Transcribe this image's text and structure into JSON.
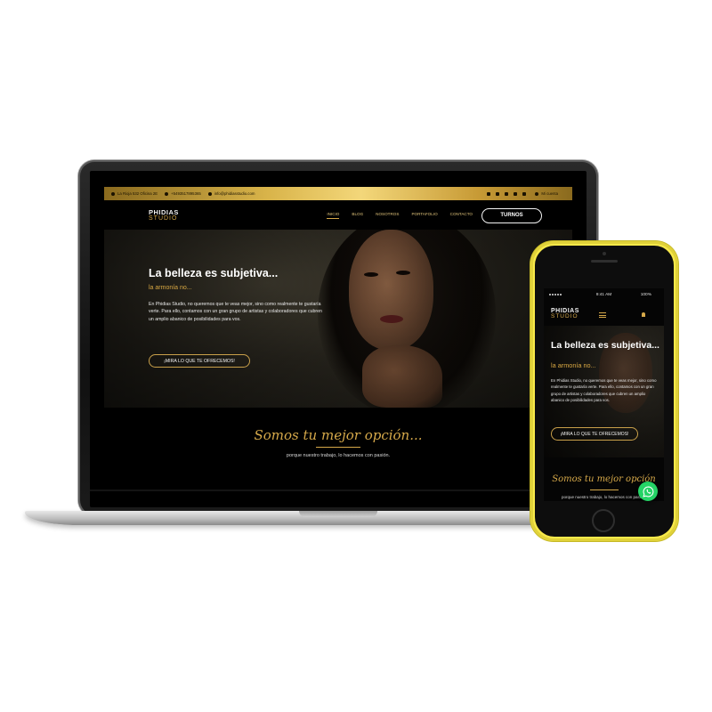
{
  "desktop": {
    "topbar": {
      "address": "La Rioja 532 Oficina 2E",
      "phone": "+5493517895365",
      "email": "info@phidiasstudio.com",
      "account_label": "Mi cuenta",
      "socials": [
        "facebook-icon",
        "twitter-icon",
        "youtube-icon",
        "tiktok-icon",
        "instagram-icon"
      ]
    },
    "logo": {
      "top": "PHIDIAS",
      "bottom": "STUDIO"
    },
    "nav": [
      "INICIO",
      "BLOG",
      "NOSOTROS",
      "PORTAFOLIO",
      "CONTACTO"
    ],
    "turnos_label": "TURNOS",
    "hero": {
      "title": "La belleza es subjetiva...",
      "subtitle": "la armonía no...",
      "text": "En Phidias Studio, no queremos que te veas mejor, sino como realmente te gustaría verte. Para ello, contamos con un gran grupo de artistas y colaboradores que cubren un amplio abanico de posibilidades para vos.",
      "cta": "¡MIRA LO QUE TE OFRECEMOS!"
    },
    "section": {
      "title": "Somos tu mejor opción...",
      "subtitle": "porque nuestro trabajo, lo hacemos con pasión."
    }
  },
  "mobile": {
    "status": {
      "time": "9:41 AM",
      "battery": "100%"
    },
    "logo": {
      "top": "PHIDIAS",
      "bottom": "STUDIO"
    },
    "hero": {
      "title": "La belleza es subjetiva...",
      "subtitle": "la armonía no...",
      "text": "En Phidias Studio, no queremos que te veas mejor, sino como realmente te gustaría verte. Para ello, contamos con un gran grupo de artistas y colaboradores que cubren un amplio abanico de posibilidades para vos.",
      "cta": "¡MIRA LO QUE TE OFRECEMOS!"
    },
    "section": {
      "title": "Somos tu mejor opción",
      "subtitle": "porque nuestro trabajo, lo hacemos con pasión."
    }
  },
  "colors": {
    "gold": "#d6a94a",
    "phone_body": "#f7e94a",
    "whatsapp": "#25d366"
  }
}
